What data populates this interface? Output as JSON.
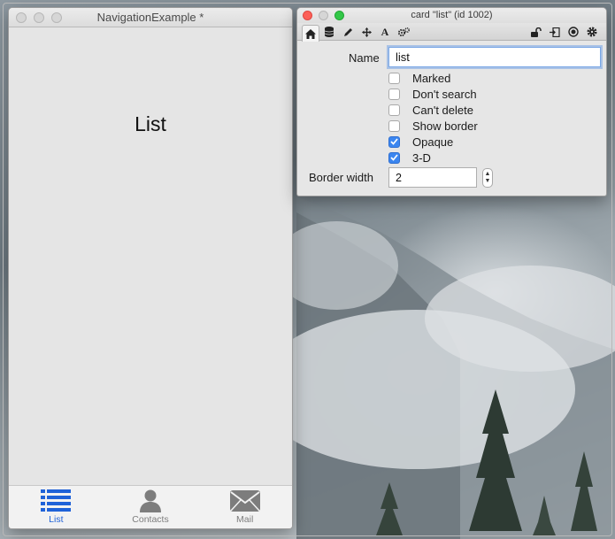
{
  "left_window": {
    "title": "NavigationExample *",
    "card_title": "List",
    "tabs": [
      {
        "label": "List",
        "icon": "list-icon",
        "active": true
      },
      {
        "label": "Contacts",
        "icon": "person-icon",
        "active": false
      },
      {
        "label": "Mail",
        "icon": "mail-icon",
        "active": false
      }
    ]
  },
  "inspector": {
    "title": "card \"list\" (id 1002)",
    "toolbar_icons": [
      "home-icon",
      "database-icon",
      "pencil-icon",
      "move-icon",
      "text-icon",
      "gears-icon",
      "unlock-icon",
      "exit-icon",
      "target-icon",
      "gear-icon"
    ],
    "name_label": "Name",
    "name_value": "list",
    "checkboxes": [
      {
        "label": "Marked",
        "checked": false
      },
      {
        "label": "Don't search",
        "checked": false
      },
      {
        "label": "Can't delete",
        "checked": false
      },
      {
        "label": "Show border",
        "checked": false
      },
      {
        "label": "Opaque",
        "checked": true
      },
      {
        "label": "3-D",
        "checked": true
      }
    ],
    "border_width_label": "Border width",
    "border_width_value": "2"
  },
  "colors": {
    "accent": "#1f62d8",
    "checkbox_checked": "#3b86f0",
    "close_button": "#fc5f57",
    "zoom_button": "#33c748"
  }
}
